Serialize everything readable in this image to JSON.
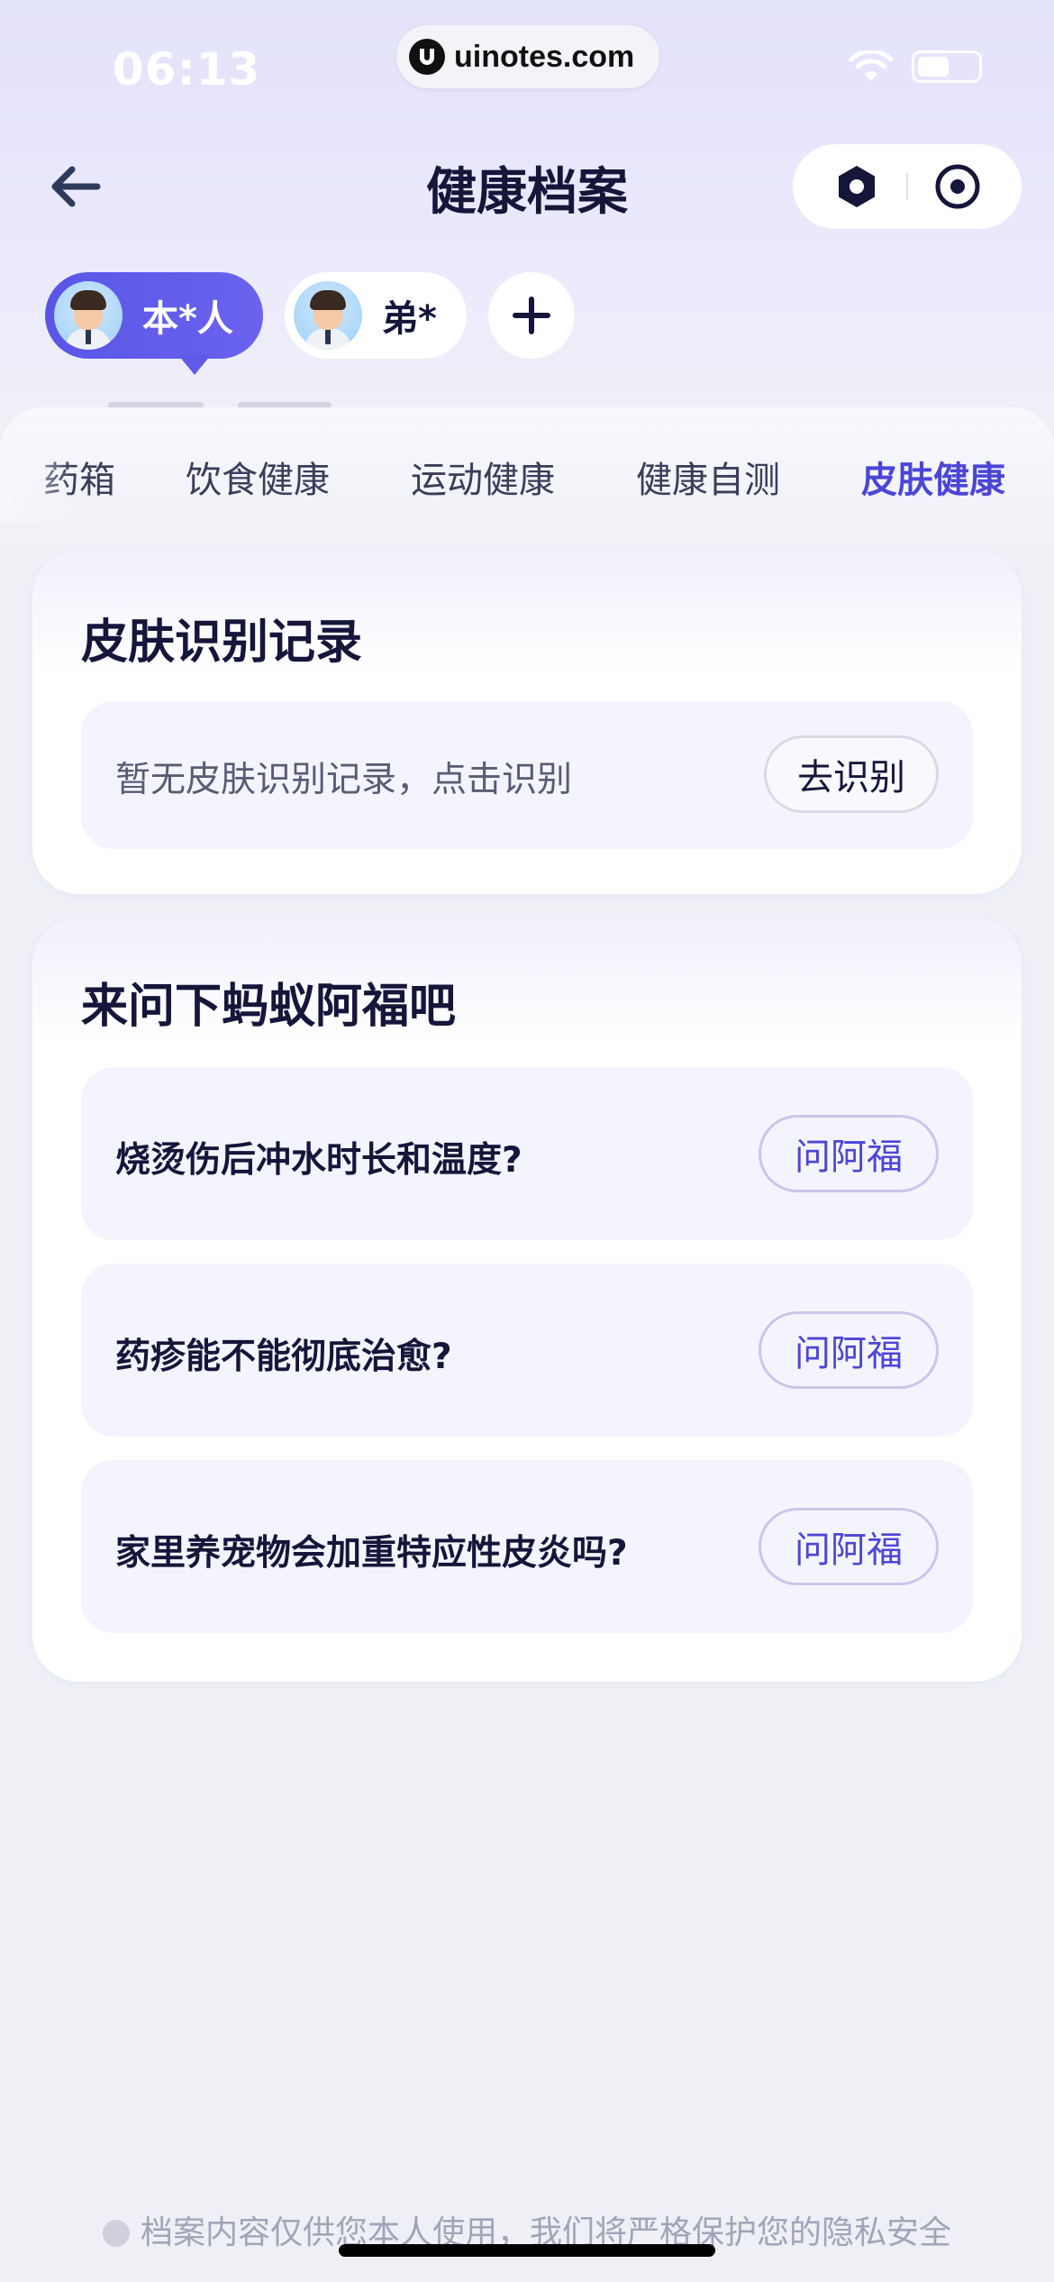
{
  "status_bar": {
    "time": "06:13",
    "watermark": "uinotes.com"
  },
  "header": {
    "title": "健康档案"
  },
  "profiles": [
    {
      "label": "本*人",
      "active": true
    },
    {
      "label": "弟*",
      "active": false
    }
  ],
  "tabs": [
    {
      "label": "药箱",
      "active": false
    },
    {
      "label": "饮食健康",
      "active": false
    },
    {
      "label": "运动健康",
      "active": false
    },
    {
      "label": "健康自测",
      "active": false
    },
    {
      "label": "皮肤健康",
      "active": true
    }
  ],
  "skin_card": {
    "title": "皮肤识别记录",
    "empty_text": "暂无皮肤识别记录，点击识别",
    "button": "去识别"
  },
  "ask_card": {
    "title": "来问下蚂蚁阿福吧",
    "questions": [
      {
        "text": "烧烫伤后冲水时长和温度?",
        "button": "问阿福"
      },
      {
        "text": "药疹能不能彻底治愈?",
        "button": "问阿福"
      },
      {
        "text": "家里养宠物会加重特应性皮炎吗?",
        "button": "问阿福"
      }
    ]
  },
  "footer": {
    "note": "档案内容仅供您本人使用，我们将严格保护您的隐私安全"
  },
  "icons": [
    "back-arrow-icon",
    "settings-hex-icon",
    "eye-icon",
    "plus-icon",
    "wifi-icon",
    "battery-icon",
    "shield-icon"
  ],
  "colors": {
    "accent": "#4b46d6",
    "pill_active": "#5f5ae8",
    "title": "#15163a"
  }
}
